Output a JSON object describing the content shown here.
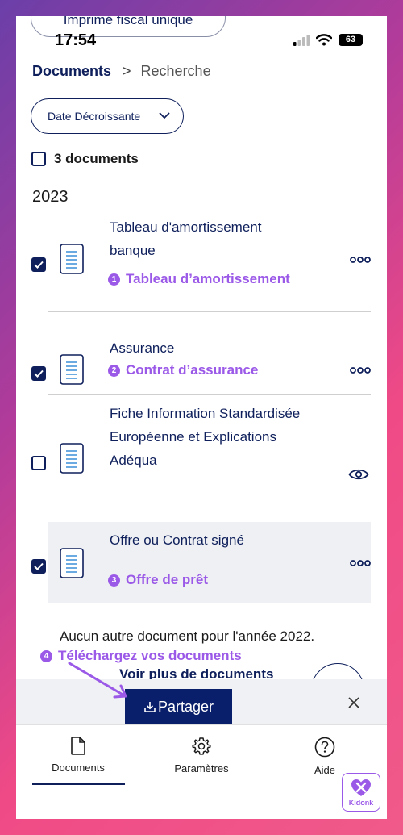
{
  "peek_pill": {
    "label": "Imprimé fiscal unique"
  },
  "status_bar": {
    "time": "17:54",
    "battery": "63"
  },
  "breadcrumb": {
    "root": "Documents",
    "separator": ">",
    "current": "Recherche"
  },
  "sort": {
    "label": "Date Décroissante"
  },
  "select_all": {
    "label": "3 documents"
  },
  "year_heading": "2023",
  "documents": [
    {
      "title_line1": "Tableau d'amortissement",
      "title_line2": "banque",
      "checked": true,
      "tag_num": "1",
      "tag": "Tableau d’amortissement",
      "action": "more-icon"
    },
    {
      "title_line1": "Assurance",
      "checked": true,
      "tag_num": "2",
      "tag": "Contrat d’assurance",
      "action": "more-icon"
    },
    {
      "title_line1": "Fiche Information Standardisée",
      "title_line2": "Européenne et Explications",
      "title_line3": "Adéqua",
      "checked": false,
      "action": "eye-icon"
    },
    {
      "title_line1": "Offre ou Contrat signé",
      "checked": true,
      "tag_num": "3",
      "tag": "Offre de prêt",
      "action": "more-icon"
    }
  ],
  "no_more_text": "Aucun autre document pour l'année 2022.",
  "annotation4": {
    "num": "4",
    "text": "Téléchargez vos documents"
  },
  "more_docs_label": "Voir plus de documents",
  "share_button": {
    "label": "Partager"
  },
  "tabs": [
    {
      "label": "Documents",
      "icon": "document-icon",
      "active": true
    },
    {
      "label": "Paramètres",
      "icon": "gear-icon",
      "active": false
    },
    {
      "label": "Aide",
      "icon": "help-icon",
      "active": false
    }
  ],
  "watermark": {
    "label": "Kidonk"
  },
  "colors": {
    "navy": "#0e1f5b",
    "accent_purple": "#9b59e8",
    "share_button": "#0a1f6b"
  }
}
